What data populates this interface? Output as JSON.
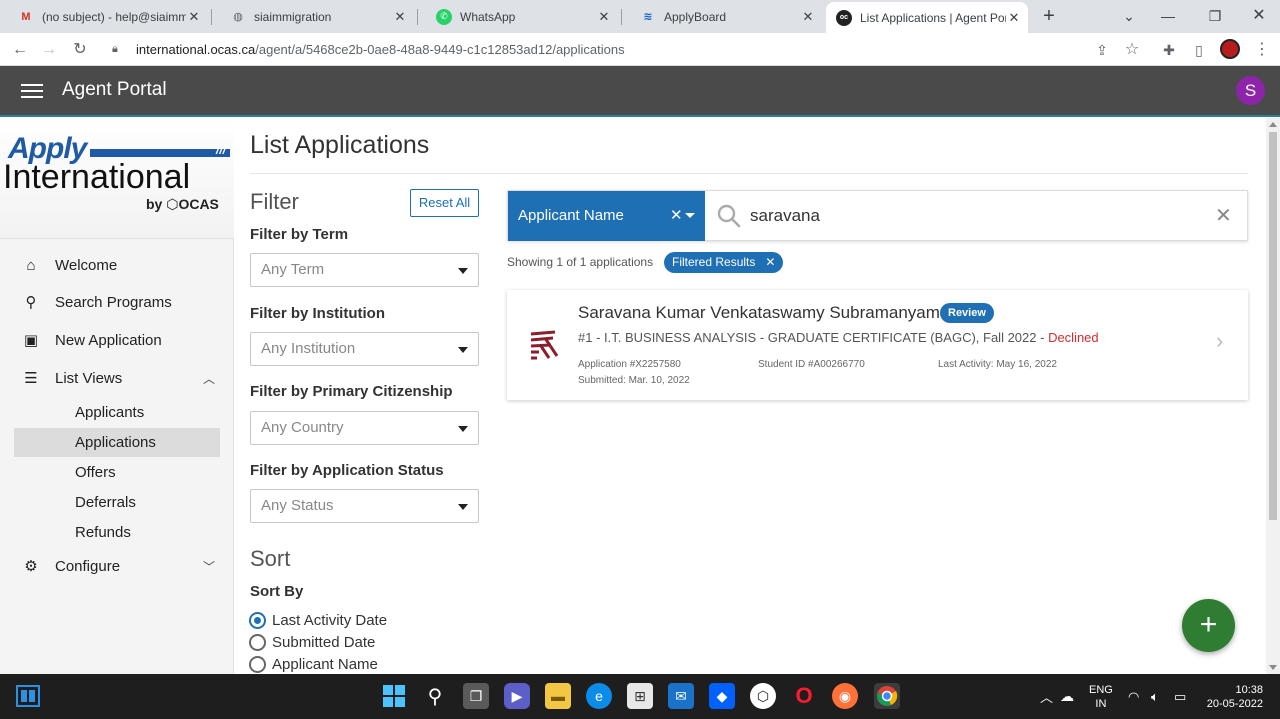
{
  "browser": {
    "tabs": [
      {
        "title": "(no subject) - help@siaimmig",
        "icon": "gmail-icon",
        "active": false
      },
      {
        "title": "siaimmigration",
        "icon": "globe-icon",
        "active": false
      },
      {
        "title": "WhatsApp",
        "icon": "whatsapp-icon",
        "active": false
      },
      {
        "title": "ApplyBoard",
        "icon": "applyboard-icon",
        "active": false
      },
      {
        "title": "List Applications | Agent Port",
        "icon": "ocas-icon",
        "active": true
      }
    ],
    "url_domain": "international.ocas.ca",
    "url_path": "/agent/a/5468ce2b-0ae8-48a8-9449-c1c12853ad12/applications"
  },
  "header": {
    "title": "Agent Portal",
    "avatar_letter": "S"
  },
  "logo": {
    "apply": "Apply",
    "international": "International",
    "by": "by ⬡OCAS"
  },
  "sidebar": {
    "items": [
      {
        "label": "Welcome",
        "icon": "home-icon"
      },
      {
        "label": "Search Programs",
        "icon": "search-icon"
      },
      {
        "label": "New Application",
        "icon": "add-document-icon"
      },
      {
        "label": "List Views",
        "icon": "list-icon"
      },
      {
        "label": "Configure",
        "icon": "gear-icon"
      }
    ],
    "sub_items": [
      {
        "label": "Applicants"
      },
      {
        "label": "Applications",
        "selected": true
      },
      {
        "label": "Offers"
      },
      {
        "label": "Deferrals"
      },
      {
        "label": "Refunds"
      }
    ]
  },
  "main": {
    "title": "List Applications",
    "filter": {
      "heading": "Filter",
      "reset_label": "Reset All",
      "groups": [
        {
          "label": "Filter by Term",
          "placeholder": "Any Term"
        },
        {
          "label": "Filter by Institution",
          "placeholder": "Any Institution"
        },
        {
          "label": "Filter by Primary Citizenship",
          "placeholder": "Any Country"
        },
        {
          "label": "Filter by Application Status",
          "placeholder": "Any Status"
        }
      ]
    },
    "sort": {
      "heading": "Sort",
      "sort_by_label": "Sort By",
      "options": [
        {
          "label": "Last Activity Date",
          "selected": true
        },
        {
          "label": "Submitted Date",
          "selected": false
        },
        {
          "label": "Applicant Name",
          "selected": false
        }
      ]
    },
    "search": {
      "type_label": "Applicant Name",
      "query": "saravana"
    },
    "results": {
      "showing_text": "Showing 1 of 1 applications",
      "chip_label": "Filtered Results"
    },
    "applications": [
      {
        "name": "Saravana Kumar Venkataswamy Subramanyam",
        "badge": "Review",
        "program": "#1 - I.T. BUSINESS ANALYSIS - GRADUATE CERTIFICATE (BAGC), Fall 2022 -",
        "status": "Declined",
        "application_number": "Application #X2257580",
        "submitted": "Submitted: Mar. 10, 2022",
        "student_id": "Student ID #A00266770",
        "last_activity": "Last Activity: May 16, 2022"
      }
    ]
  },
  "taskbar": {
    "lang_top": "ENG",
    "lang_bottom": "IN",
    "time": "10:38",
    "date": "20-05-2022"
  },
  "colors": {
    "primary": "#1f6fb4",
    "header_bg": "#4a4a4a",
    "avatar": "#8e24aa",
    "fab": "#2e7d32",
    "declined": "#d32f2f"
  }
}
